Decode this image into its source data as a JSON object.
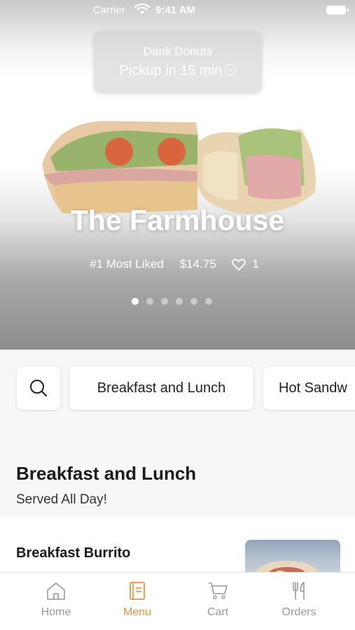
{
  "status_bar": {
    "carrier": "Carrier",
    "time": "9:41 AM"
  },
  "pickup": {
    "store": "Dank Donuts",
    "time": "Pickup in 15 min"
  },
  "hero": {
    "title": "The Farmhouse",
    "rank": "#1 Most Liked",
    "price": "$14.75",
    "likes": "1",
    "slide_count": 6,
    "active_slide": 1
  },
  "chips": {
    "search_icon": "search-icon",
    "items": [
      "Breakfast and Lunch",
      "Hot Sandw"
    ]
  },
  "section": {
    "title": "Breakfast and Lunch",
    "subtitle": "Served All Day!"
  },
  "items": [
    {
      "name": "Breakfast Burrito",
      "description": ""
    }
  ],
  "tabbar": {
    "tabs": [
      {
        "label": "Home",
        "icon": "home-icon"
      },
      {
        "label": "Menu",
        "icon": "menu-icon",
        "active": true
      },
      {
        "label": "Cart",
        "icon": "cart-icon"
      },
      {
        "label": "Orders",
        "icon": "orders-icon"
      }
    ],
    "active_color": "#f0923a",
    "inactive_color": "#9a9a9a"
  }
}
